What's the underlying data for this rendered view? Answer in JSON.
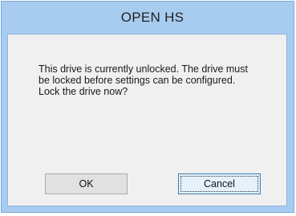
{
  "dialog": {
    "title": "OPEN HS",
    "message": "This drive is currently unlocked. The drive must be locked before settings can be configured. Lock the drive now?",
    "buttons": {
      "ok_label": "OK",
      "cancel_label": "Cancel"
    },
    "focused_button": "cancel"
  },
  "colors": {
    "frame": "#a8ccf0",
    "client_background": "#f0f0f0",
    "button_background": "#e1e1e1",
    "focused_button_border": "#3c7fb1"
  }
}
